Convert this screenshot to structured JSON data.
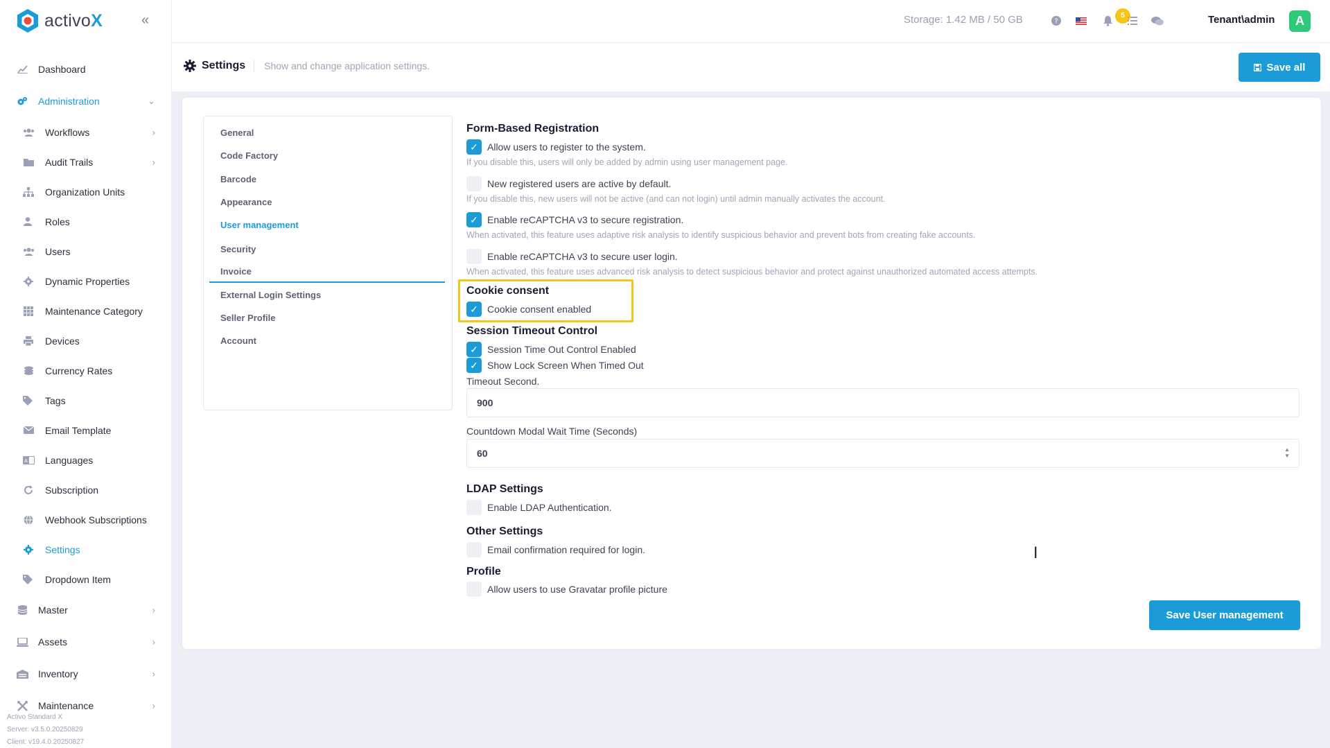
{
  "app": {
    "logo_text_a": "activo",
    "logo_text_b": "X"
  },
  "sidebar": {
    "items": [
      {
        "label": "Dashboard",
        "level": "top",
        "icon": "chart-line-icon"
      },
      {
        "label": "Administration",
        "level": "top",
        "icon": "cogs-icon",
        "active": true,
        "expanded": true
      },
      {
        "label": "Workflows",
        "level": "sub",
        "icon": "users-icon",
        "has_children": true
      },
      {
        "label": "Audit Trails",
        "level": "sub",
        "icon": "folder-icon",
        "has_children": true
      },
      {
        "label": "Organization Units",
        "level": "sub",
        "icon": "sitemap-icon"
      },
      {
        "label": "Roles",
        "level": "sub",
        "icon": "user-tag-icon"
      },
      {
        "label": "Users",
        "level": "sub",
        "icon": "users-icon"
      },
      {
        "label": "Dynamic Properties",
        "level": "sub",
        "icon": "gear-icon"
      },
      {
        "label": "Maintenance Category",
        "level": "sub",
        "icon": "grid-icon"
      },
      {
        "label": "Devices",
        "level": "sub",
        "icon": "printer-icon"
      },
      {
        "label": "Currency Rates",
        "level": "sub",
        "icon": "coins-icon"
      },
      {
        "label": "Tags",
        "level": "sub",
        "icon": "tags-icon"
      },
      {
        "label": "Email Template",
        "level": "sub",
        "icon": "envelope-icon"
      },
      {
        "label": "Languages",
        "level": "sub",
        "icon": "language-icon"
      },
      {
        "label": "Subscription",
        "level": "sub",
        "icon": "refresh-icon"
      },
      {
        "label": "Webhook Subscriptions",
        "level": "sub",
        "icon": "globe-icon"
      },
      {
        "label": "Settings",
        "level": "sub",
        "icon": "gear-icon",
        "active": true
      },
      {
        "label": "Dropdown Item",
        "level": "sub",
        "icon": "tags-icon"
      },
      {
        "label": "Master",
        "level": "top",
        "icon": "database-icon",
        "has_children": true
      },
      {
        "label": "Assets",
        "level": "top",
        "icon": "laptop-icon",
        "has_children": true
      },
      {
        "label": "Inventory",
        "level": "top",
        "icon": "warehouse-icon",
        "has_children": true
      },
      {
        "label": "Maintenance",
        "level": "top",
        "icon": "tools-icon",
        "has_children": true
      }
    ],
    "footer": {
      "product": "Activo Standard X",
      "server": "Server: v3.5.0.20250829",
      "client": "Client: v19.4.0.20250827"
    }
  },
  "header": {
    "storage": "Storage: 1.42 MB / 50 GB",
    "notification_count": "5",
    "user": "Tenant\\admin",
    "avatar_letter": "A"
  },
  "subheader": {
    "title": "Settings",
    "subtitle": "Show and change application settings.",
    "save_all": "Save all"
  },
  "tabs": [
    {
      "label": "General"
    },
    {
      "label": "Code Factory"
    },
    {
      "label": "Barcode"
    },
    {
      "label": "Appearance"
    },
    {
      "label": "User management",
      "active": true
    },
    {
      "label": "Security"
    },
    {
      "label": "Invoice"
    },
    {
      "label": "External Login Settings"
    },
    {
      "label": "Seller Profile"
    },
    {
      "label": "Account"
    }
  ],
  "form": {
    "registration_title": "Form-Based Registration",
    "allow_register": {
      "label": "Allow users to register to the system.",
      "checked": true,
      "help": "If you disable this, users will only be added by admin using user management page."
    },
    "new_active": {
      "label": "New registered users are active by default.",
      "checked": false,
      "help": "If you disable this, new users will not be active (and can not login) until admin manually activates the account."
    },
    "recaptcha_reg": {
      "label": "Enable reCAPTCHA v3 to secure registration.",
      "checked": true,
      "help": "When activated, this feature uses adaptive risk analysis to identify suspicious behavior and prevent bots from creating fake accounts."
    },
    "recaptcha_login": {
      "label": "Enable reCAPTCHA v3 to secure user login.",
      "checked": false,
      "help": "When activated, this feature uses advanced risk analysis to detect suspicious behavior and protect against unauthorized automated access attempts."
    },
    "cookie_title": "Cookie consent",
    "cookie_enabled": {
      "label": "Cookie consent enabled",
      "checked": true
    },
    "session_title": "Session Timeout Control",
    "session_enabled": {
      "label": "Session Time Out Control Enabled",
      "checked": true
    },
    "lock_screen": {
      "label": "Show Lock Screen When Timed Out",
      "checked": true
    },
    "timeout_label": "Timeout Second.",
    "timeout_value": "900",
    "countdown_label": "Countdown Modal Wait Time (Seconds)",
    "countdown_value": "60",
    "ldap_title": "LDAP Settings",
    "ldap_enabled": {
      "label": "Enable LDAP Authentication.",
      "checked": false
    },
    "other_title": "Other Settings",
    "email_confirm": {
      "label": "Email confirmation required for login.",
      "checked": false
    },
    "profile_title": "Profile",
    "gravatar": {
      "label": "Allow users to use Gravatar profile picture",
      "checked": false
    },
    "save_button": "Save User management"
  },
  "colors": {
    "primary": "#1b9cd8",
    "highlight": "#f5c518",
    "avatar": "#2fc97a"
  }
}
